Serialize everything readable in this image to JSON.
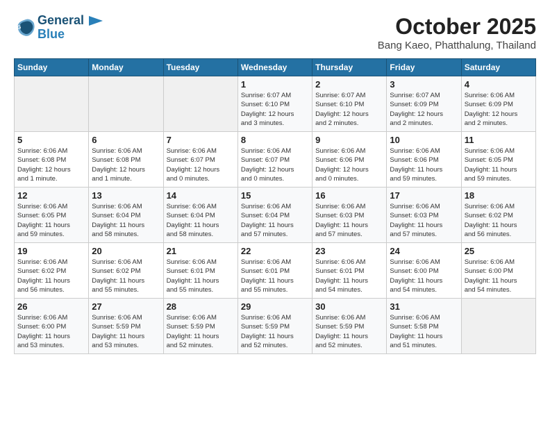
{
  "header": {
    "logo_line1": "General",
    "logo_line2": "Blue",
    "month": "October 2025",
    "location": "Bang Kaeo, Phatthalung, Thailand"
  },
  "weekdays": [
    "Sunday",
    "Monday",
    "Tuesday",
    "Wednesday",
    "Thursday",
    "Friday",
    "Saturday"
  ],
  "weeks": [
    [
      {
        "day": "",
        "info": ""
      },
      {
        "day": "",
        "info": ""
      },
      {
        "day": "",
        "info": ""
      },
      {
        "day": "1",
        "info": "Sunrise: 6:07 AM\nSunset: 6:10 PM\nDaylight: 12 hours\nand 3 minutes."
      },
      {
        "day": "2",
        "info": "Sunrise: 6:07 AM\nSunset: 6:10 PM\nDaylight: 12 hours\nand 2 minutes."
      },
      {
        "day": "3",
        "info": "Sunrise: 6:07 AM\nSunset: 6:09 PM\nDaylight: 12 hours\nand 2 minutes."
      },
      {
        "day": "4",
        "info": "Sunrise: 6:06 AM\nSunset: 6:09 PM\nDaylight: 12 hours\nand 2 minutes."
      }
    ],
    [
      {
        "day": "5",
        "info": "Sunrise: 6:06 AM\nSunset: 6:08 PM\nDaylight: 12 hours\nand 1 minute."
      },
      {
        "day": "6",
        "info": "Sunrise: 6:06 AM\nSunset: 6:08 PM\nDaylight: 12 hours\nand 1 minute."
      },
      {
        "day": "7",
        "info": "Sunrise: 6:06 AM\nSunset: 6:07 PM\nDaylight: 12 hours\nand 0 minutes."
      },
      {
        "day": "8",
        "info": "Sunrise: 6:06 AM\nSunset: 6:07 PM\nDaylight: 12 hours\nand 0 minutes."
      },
      {
        "day": "9",
        "info": "Sunrise: 6:06 AM\nSunset: 6:06 PM\nDaylight: 12 hours\nand 0 minutes."
      },
      {
        "day": "10",
        "info": "Sunrise: 6:06 AM\nSunset: 6:06 PM\nDaylight: 11 hours\nand 59 minutes."
      },
      {
        "day": "11",
        "info": "Sunrise: 6:06 AM\nSunset: 6:05 PM\nDaylight: 11 hours\nand 59 minutes."
      }
    ],
    [
      {
        "day": "12",
        "info": "Sunrise: 6:06 AM\nSunset: 6:05 PM\nDaylight: 11 hours\nand 59 minutes."
      },
      {
        "day": "13",
        "info": "Sunrise: 6:06 AM\nSunset: 6:04 PM\nDaylight: 11 hours\nand 58 minutes."
      },
      {
        "day": "14",
        "info": "Sunrise: 6:06 AM\nSunset: 6:04 PM\nDaylight: 11 hours\nand 58 minutes."
      },
      {
        "day": "15",
        "info": "Sunrise: 6:06 AM\nSunset: 6:04 PM\nDaylight: 11 hours\nand 57 minutes."
      },
      {
        "day": "16",
        "info": "Sunrise: 6:06 AM\nSunset: 6:03 PM\nDaylight: 11 hours\nand 57 minutes."
      },
      {
        "day": "17",
        "info": "Sunrise: 6:06 AM\nSunset: 6:03 PM\nDaylight: 11 hours\nand 57 minutes."
      },
      {
        "day": "18",
        "info": "Sunrise: 6:06 AM\nSunset: 6:02 PM\nDaylight: 11 hours\nand 56 minutes."
      }
    ],
    [
      {
        "day": "19",
        "info": "Sunrise: 6:06 AM\nSunset: 6:02 PM\nDaylight: 11 hours\nand 56 minutes."
      },
      {
        "day": "20",
        "info": "Sunrise: 6:06 AM\nSunset: 6:02 PM\nDaylight: 11 hours\nand 55 minutes."
      },
      {
        "day": "21",
        "info": "Sunrise: 6:06 AM\nSunset: 6:01 PM\nDaylight: 11 hours\nand 55 minutes."
      },
      {
        "day": "22",
        "info": "Sunrise: 6:06 AM\nSunset: 6:01 PM\nDaylight: 11 hours\nand 55 minutes."
      },
      {
        "day": "23",
        "info": "Sunrise: 6:06 AM\nSunset: 6:01 PM\nDaylight: 11 hours\nand 54 minutes."
      },
      {
        "day": "24",
        "info": "Sunrise: 6:06 AM\nSunset: 6:00 PM\nDaylight: 11 hours\nand 54 minutes."
      },
      {
        "day": "25",
        "info": "Sunrise: 6:06 AM\nSunset: 6:00 PM\nDaylight: 11 hours\nand 54 minutes."
      }
    ],
    [
      {
        "day": "26",
        "info": "Sunrise: 6:06 AM\nSunset: 6:00 PM\nDaylight: 11 hours\nand 53 minutes."
      },
      {
        "day": "27",
        "info": "Sunrise: 6:06 AM\nSunset: 5:59 PM\nDaylight: 11 hours\nand 53 minutes."
      },
      {
        "day": "28",
        "info": "Sunrise: 6:06 AM\nSunset: 5:59 PM\nDaylight: 11 hours\nand 52 minutes."
      },
      {
        "day": "29",
        "info": "Sunrise: 6:06 AM\nSunset: 5:59 PM\nDaylight: 11 hours\nand 52 minutes."
      },
      {
        "day": "30",
        "info": "Sunrise: 6:06 AM\nSunset: 5:59 PM\nDaylight: 11 hours\nand 52 minutes."
      },
      {
        "day": "31",
        "info": "Sunrise: 6:06 AM\nSunset: 5:58 PM\nDaylight: 11 hours\nand 51 minutes."
      },
      {
        "day": "",
        "info": ""
      }
    ]
  ]
}
